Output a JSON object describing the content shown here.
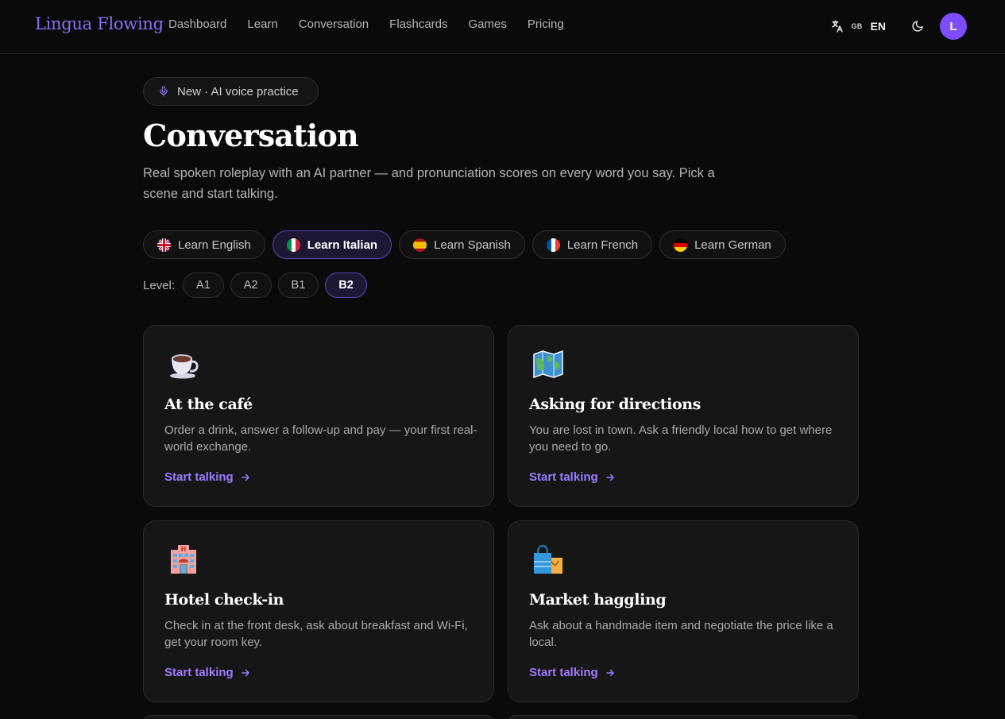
{
  "nav": {
    "logo": "Lingua Flowing",
    "links": [
      "Dashboard",
      "Learn",
      "Conversation",
      "Flashcards",
      "Games",
      "Pricing"
    ],
    "lang_region": "GB",
    "lang_code": "EN",
    "avatar_initial": "L"
  },
  "hero": {
    "badge": "New · AI voice practice",
    "title": "Conversation",
    "subtitle": "Real spoken roleplay with an AI partner — and pronunciation scores on every word you say. Pick a scene and start talking."
  },
  "languages": [
    {
      "label": "Learn English",
      "flag": "uk-flag-icon",
      "active": false
    },
    {
      "label": "Learn Italian",
      "flag": "italy-flag-icon",
      "active": true
    },
    {
      "label": "Learn Spanish",
      "flag": "spain-flag-icon",
      "active": false
    },
    {
      "label": "Learn French",
      "flag": "france-flag-icon",
      "active": false
    },
    {
      "label": "Learn German",
      "flag": "germany-flag-icon",
      "active": false
    }
  ],
  "level": {
    "label": "Level:",
    "options": [
      "A1",
      "A2",
      "B1",
      "B2"
    ],
    "selected": "B2"
  },
  "scenes": [
    {
      "icon": "coffee-cup-icon",
      "title": "At the café",
      "description": "Order a drink, answer a follow-up and pay — your first real-world exchange.",
      "cta": "Start talking"
    },
    {
      "icon": "map-icon",
      "title": "Asking for directions",
      "description": "You are lost in town. Ask a friendly local how to get where you need to go.",
      "cta": "Start talking"
    },
    {
      "icon": "hotel-icon",
      "title": "Hotel check-in",
      "description": "Check in at the front desk, ask about breakfast and Wi-Fi, get your room key.",
      "cta": "Start talking"
    },
    {
      "icon": "shopping-bags-icon",
      "title": "Market haggling",
      "description": "Ask about a handmade item and negotiate the price like a local.",
      "cta": "Start talking"
    }
  ],
  "colors": {
    "accent": "#8b6cf6",
    "avatar": "#7c4dff",
    "background": "#0a0a0a",
    "card": "#161616",
    "cta": "#9b7cff"
  }
}
